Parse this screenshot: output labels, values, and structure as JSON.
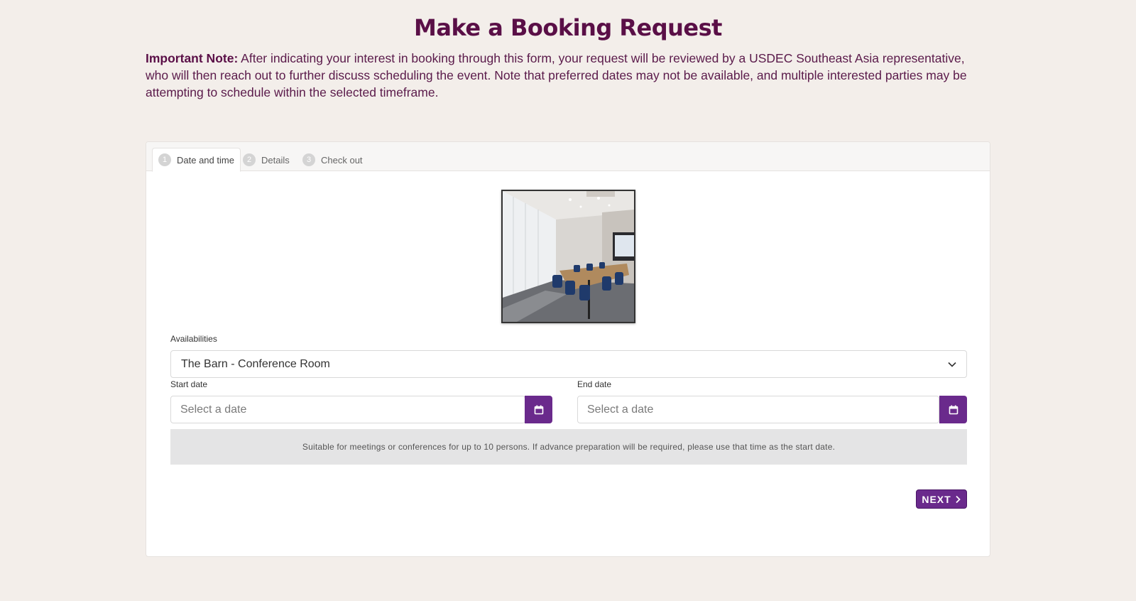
{
  "header": {
    "title": "Make a Booking Request",
    "note_label": "Important Note:",
    "note_text": " After indicating your interest in booking through this form, your request will be reviewed by a USDEC Southeast Asia representative, who will then reach out to further discuss scheduling the event. Note that preferred dates may not be available, and multiple interested parties may be attempting to schedule within the selected timeframe."
  },
  "tabs": [
    {
      "num": "1",
      "label": "Date and time",
      "active": true
    },
    {
      "num": "2",
      "label": "Details",
      "active": false
    },
    {
      "num": "3",
      "label": "Check out",
      "active": false
    }
  ],
  "form": {
    "availabilities_label": "Availabilities",
    "availabilities_value": "The Barn - Conference Room",
    "start_label": "Start date",
    "start_placeholder": "Select a date",
    "end_label": "End date",
    "end_placeholder": "Select a date",
    "info": "Suitable for meetings or conferences for up to 10 persons. If advance preparation will be required, please use that time as the start date.",
    "next_label": "NEXT"
  },
  "colors": {
    "accent": "#6a2a8c",
    "title": "#5a0f47",
    "background": "#f3eeea"
  }
}
